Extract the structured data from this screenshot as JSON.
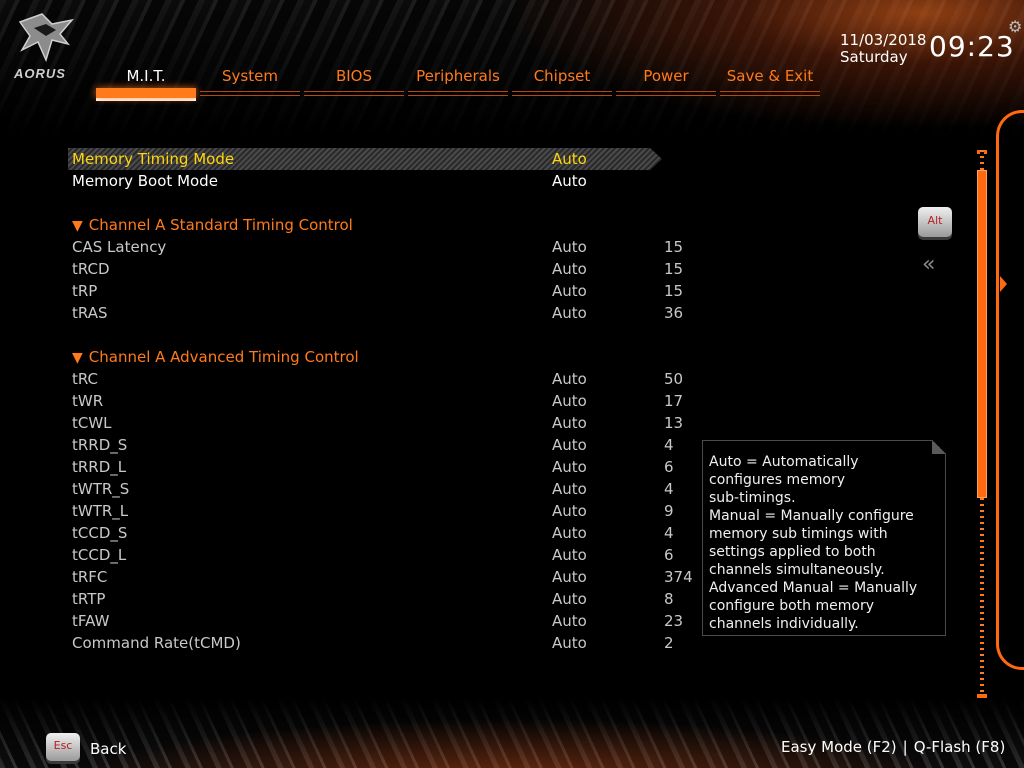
{
  "brand": {
    "logo_text": "AORUS"
  },
  "tabs": [
    {
      "label": "M.I.T.",
      "active": true
    },
    {
      "label": "System"
    },
    {
      "label": "BIOS"
    },
    {
      "label": "Peripherals"
    },
    {
      "label": "Chipset"
    },
    {
      "label": "Power"
    },
    {
      "label": "Save & Exit"
    }
  ],
  "clock": {
    "date": "11/03/2018",
    "day": "Saturday",
    "time": "09:23"
  },
  "settings": {
    "top": [
      {
        "label": "Memory Timing Mode",
        "mode": "Auto",
        "value": ""
      },
      {
        "label": "Memory Boot Mode",
        "mode": "Auto",
        "value": ""
      }
    ],
    "standard_header": "Channel A Standard Timing Control",
    "standard": [
      {
        "label": "CAS Latency",
        "mode": "Auto",
        "value": "15"
      },
      {
        "label": "tRCD",
        "mode": "Auto",
        "value": "15"
      },
      {
        "label": "tRP",
        "mode": "Auto",
        "value": "15"
      },
      {
        "label": "tRAS",
        "mode": "Auto",
        "value": "36"
      }
    ],
    "advanced_header": "Channel A Advanced Timing Control",
    "advanced": [
      {
        "label": "tRC",
        "mode": "Auto",
        "value": "50"
      },
      {
        "label": "tWR",
        "mode": "Auto",
        "value": "17"
      },
      {
        "label": "tCWL",
        "mode": "Auto",
        "value": "13"
      },
      {
        "label": "tRRD_S",
        "mode": "Auto",
        "value": "4"
      },
      {
        "label": "tRRD_L",
        "mode": "Auto",
        "value": "6"
      },
      {
        "label": "tWTR_S",
        "mode": "Auto",
        "value": "4"
      },
      {
        "label": "tWTR_L",
        "mode": "Auto",
        "value": "9"
      },
      {
        "label": "tCCD_S",
        "mode": "Auto",
        "value": "4"
      },
      {
        "label": "tCCD_L",
        "mode": "Auto",
        "value": "6"
      },
      {
        "label": "tRFC",
        "mode": "Auto",
        "value": "374"
      },
      {
        "label": "tRTP",
        "mode": "Auto",
        "value": "8"
      },
      {
        "label": "tFAW",
        "mode": "Auto",
        "value": "23"
      },
      {
        "label": "Command Rate(tCMD)",
        "mode": "Auto",
        "value": "2"
      }
    ]
  },
  "help": {
    "lines": [
      "Auto = Automatically",
      "configures memory",
      "sub-timings.",
      "Manual = Manually configure",
      "memory sub timings with",
      "settings applied to both",
      "channels simultaneously.",
      "Advanced Manual = Manually",
      "configure both memory",
      "channels individually."
    ]
  },
  "side_controls": {
    "alt_label": "Alt",
    "collapse_glyph": "«"
  },
  "footer": {
    "esc_label": "Esc",
    "back_label": "Back",
    "easy_mode": "Easy Mode (F2)",
    "separator": "|",
    "qflash": "Q-Flash (F8)"
  },
  "colors": {
    "accent": "#ff7a1a",
    "highlight_text": "#ffd60a",
    "text": "#c8c8c8"
  },
  "icons": {
    "settings": "gear-icon",
    "section_toggle": "triangle-down-icon",
    "collapse": "double-chevron-left-icon",
    "expand_panel": "arrow-right-icon"
  }
}
